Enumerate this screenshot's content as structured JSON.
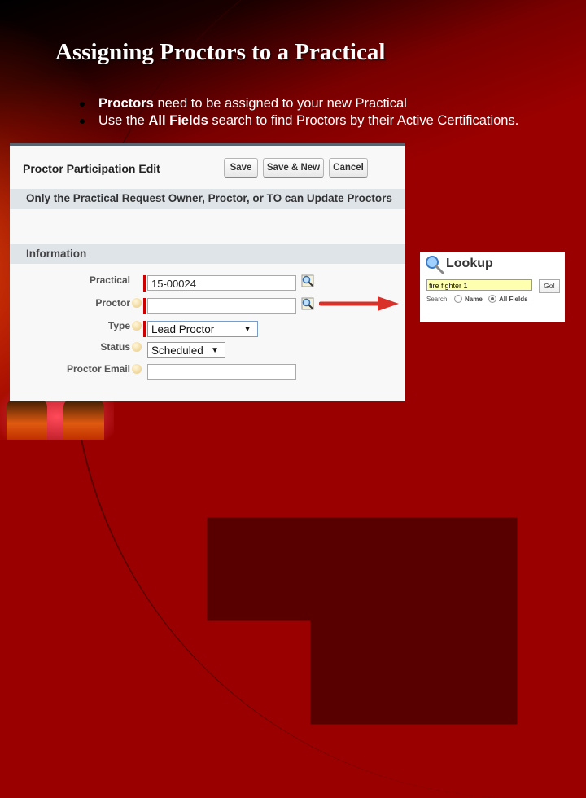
{
  "slide": {
    "title": "Assigning Proctors to a Practical",
    "bullets": [
      {
        "bold": "Proctors",
        "rest": " need to be assigned to your new Practical"
      },
      {
        "pre": "Use the ",
        "bold": "All Fields",
        "rest": " search to find Proctors by their Active Certifications."
      }
    ]
  },
  "form": {
    "title": "Proctor Participation Edit",
    "buttons": {
      "save": "Save",
      "save_new": "Save & New",
      "cancel": "Cancel"
    },
    "notice": "Only the Practical Request Owner, Proctor, or TO can Update Proctors",
    "section": "Information",
    "fields": {
      "practical": {
        "label": "Practical",
        "value": "15-00024"
      },
      "proctor": {
        "label": "Proctor",
        "value": ""
      },
      "type": {
        "label": "Type",
        "value": "Lead Proctor"
      },
      "status": {
        "label": "Status",
        "value": "Scheduled"
      },
      "email": {
        "label": "Proctor Email",
        "value": ""
      }
    }
  },
  "lookup": {
    "title": "Lookup",
    "query": "fire fighter 1",
    "go": "Go!",
    "search_label": "Search",
    "options": [
      "Name",
      "All Fields"
    ],
    "selected": "All Fields"
  },
  "colors": {
    "background": "#9a0000",
    "arrow": "#d9302a",
    "required": "#cc0000"
  }
}
